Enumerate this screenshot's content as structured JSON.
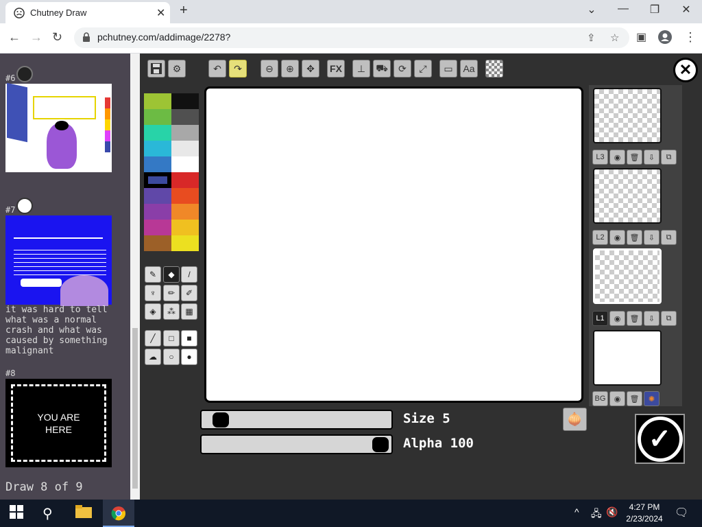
{
  "browser": {
    "tab_title": "Chutney Draw",
    "new_tab": "+",
    "url": "pchutney.com/addimage/2278?",
    "window_controls": {
      "minimize": "—",
      "restore": "❐",
      "close": "✕",
      "tab_list": "⌄"
    }
  },
  "feed": {
    "entries": [
      {
        "number": "#6"
      },
      {
        "number": "#7",
        "caption": "it was hard to tell what was a normal crash and what was caused by something malignant"
      },
      {
        "number": "#8",
        "placeholder": "YOU ARE HERE"
      }
    ],
    "progress": "Draw 8 of 9"
  },
  "toolbar": {
    "buttons": [
      "save-icon",
      "settings-icon",
      "undo-icon",
      "redo-icon",
      "zoom-out-icon",
      "zoom-in-icon",
      "move-icon",
      "fx-icon",
      "stamp-icon",
      "pan-icon",
      "rotate-icon",
      "resize-icon",
      "image-icon",
      "text-icon",
      "transparency-icon"
    ],
    "fx_label": "FX",
    "text_label": "Aa"
  },
  "palette": {
    "left": [
      "#9dc434",
      "#6cbb44",
      "#28d3a8",
      "#2ab8d8",
      "#3479c5",
      "#3c4a9e",
      "#6048a8",
      "#8a3ea8",
      "#b83896",
      "#9c6028"
    ],
    "right": [
      "#111111",
      "#505050",
      "#a8a8a8",
      "#e8e8e8",
      "#ffffff",
      "#d82828",
      "#e84c20",
      "#f08828",
      "#f0c020",
      "#ece020"
    ],
    "selected_index": 5
  },
  "brush": {
    "size_label": "Size 5",
    "alpha_label": "Alpha 100",
    "size": 5,
    "alpha": 100
  },
  "layers": {
    "items": [
      {
        "label": "L3"
      },
      {
        "label": "L2"
      },
      {
        "label": "L1",
        "selected": true
      },
      {
        "label": "BG"
      }
    ]
  },
  "taskbar": {
    "time": "4:27 PM",
    "date": "2/23/2024"
  },
  "colors": {
    "editor_bg": "#303030",
    "feed_bg": "#4a4550",
    "highlight": "#e6e07a"
  }
}
